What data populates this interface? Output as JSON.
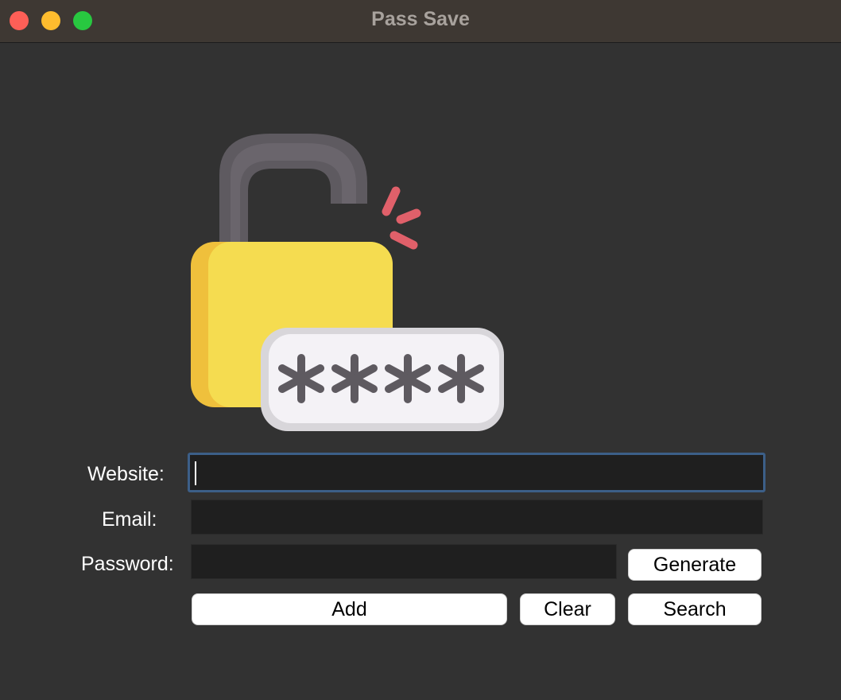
{
  "window": {
    "title": "Pass Save",
    "buttons": {
      "close_color": "#fe5f57",
      "minimize_color": "#febc2e",
      "maximize_color": "#28c840"
    }
  },
  "logo": {
    "icon": "unlocked-padlock-password-icon",
    "password_mask": "****"
  },
  "form": {
    "website": {
      "label": "Website:",
      "value": "",
      "placeholder": "",
      "focused": true
    },
    "email": {
      "label": "Email:",
      "value": "",
      "placeholder": ""
    },
    "password": {
      "label": "Password:",
      "value": "",
      "placeholder": ""
    }
  },
  "actions": {
    "generate_label": "Generate",
    "add_label": "Add",
    "clear_label": "Clear",
    "search_label": "Search"
  },
  "colors": {
    "background": "#323232",
    "field_background": "#1f1f1f",
    "focus_ring": "#3c5f88",
    "lock_body": "#f5dc50",
    "lock_shackle": "#5e5a60",
    "spark": "#e0606a"
  }
}
